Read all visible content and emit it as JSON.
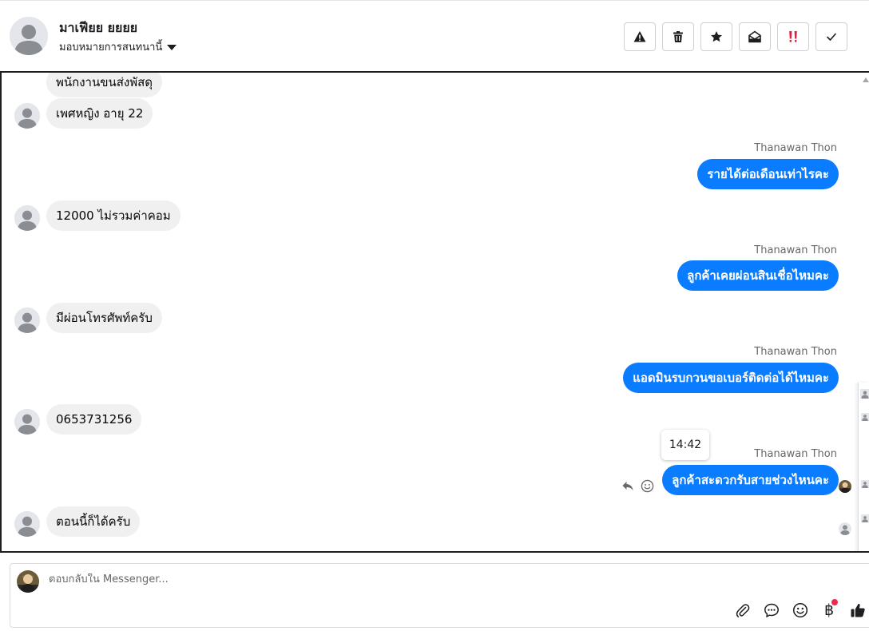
{
  "header": {
    "name": "มาเฟียย ยยยย",
    "assign_label": "มอบหมายการสนทนานี้",
    "actions": [
      {
        "icon": "warning-icon",
        "label": "spam"
      },
      {
        "icon": "trash-icon",
        "label": "delete"
      },
      {
        "icon": "star-icon",
        "label": "star"
      },
      {
        "icon": "envelope-open-icon",
        "label": "mark-unread"
      },
      {
        "icon": "priority-icon",
        "label": "priority"
      },
      {
        "icon": "check-icon",
        "label": "done"
      }
    ]
  },
  "messages": [
    {
      "dir": "in",
      "text": "พนักงานขนส่งพัสดุ"
    },
    {
      "dir": "in",
      "text": "เพศหญิง อายุ 22"
    },
    {
      "dir": "out",
      "sender": "Thanawan Thon",
      "text": "รายได้ต่อเดือนเท่าไรคะ"
    },
    {
      "dir": "in",
      "text": "12000 ไม่รวมค่าคอม"
    },
    {
      "dir": "out",
      "sender": "Thanawan Thon",
      "text": "ลูกค้าเคยผ่อนสินเชื่อไหมคะ"
    },
    {
      "dir": "in",
      "text": "มีผ่อนโทรศัพท์ครับ"
    },
    {
      "dir": "out",
      "sender": "Thanawan Thon",
      "text": "แอดมินรบกวนขอเบอร์ติดต่อได้ไหมคะ"
    },
    {
      "dir": "in",
      "text": "0653731256"
    },
    {
      "dir": "out",
      "sender": "Thanawan Thon",
      "text": "ลูกค้าสะดวกรับสายช่วงไหนคะ",
      "time": "14:42"
    },
    {
      "dir": "in",
      "text": "ตอนนี้ก็ได้ครับ"
    }
  ],
  "composer": {
    "placeholder": "ตอบกลับใน Messenger...",
    "tools": [
      "paperclip-icon",
      "chat-bubble-icon",
      "smiley-icon",
      "baht-icon",
      "thumbs-up-icon"
    ],
    "baht_symbol": "฿"
  },
  "colors": {
    "outgoing": "#0a7cff",
    "incoming": "#f0f0f0",
    "notification": "#f02849",
    "priority": "#e41e3f"
  }
}
